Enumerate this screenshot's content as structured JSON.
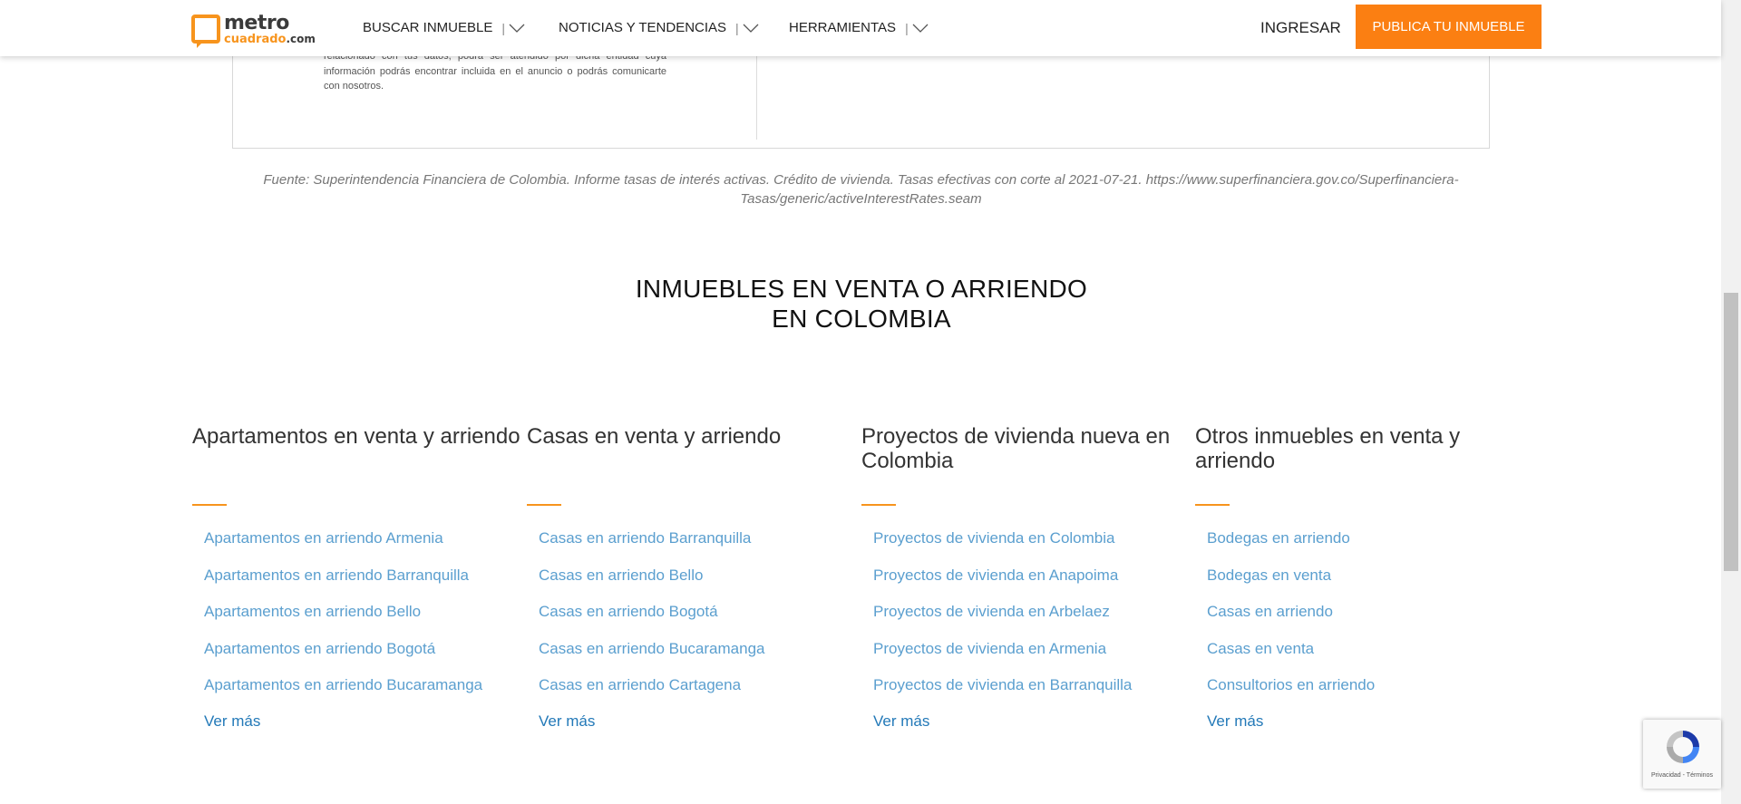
{
  "header": {
    "logo_main": "metro",
    "logo_sub": "cuadrado",
    "logo_tld": ".com",
    "nav": [
      {
        "label": "BUSCAR INMUEBLE"
      },
      {
        "label": "NOTICIAS Y TENDENCIAS"
      },
      {
        "label": "HERRAMIENTAS"
      }
    ],
    "separator": "|",
    "login_label": "INGRESAR",
    "publish_label": "PUBLICA TU INMUEBLE"
  },
  "card": {
    "text_partial": "relacionado con tus datos, podrá ser atendido por dicha entidad cuya información podrás encontrar incluida en el anuncio o podrás comunicarte con nosotros."
  },
  "source_note": "Fuente: Superintendencia Financiera de Colombia. Informe tasas de interés activas. Crédito de vivienda. Tasas efectivas con corte al 2021-07-21. https://www.superfinanciera.gov.co/Superfinanciera-Tasas/generic/activeInterestRates.seam",
  "section": {
    "title_line1": "INMUEBLES EN VENTA O ARRIENDO",
    "title_line2": "EN COLOMBIA",
    "columns": [
      {
        "heading": "Apartamentos en venta y arriendo",
        "links": [
          "Apartamentos en arriendo Armenia",
          "Apartamentos en arriendo Barranquilla",
          "Apartamentos en arriendo Bello",
          "Apartamentos en arriendo Bogotá",
          "Apartamentos en arriendo Bucaramanga"
        ],
        "more": "Ver más"
      },
      {
        "heading": "Casas en venta y arriendo",
        "links": [
          "Casas en arriendo Barranquilla",
          "Casas en arriendo Bello",
          "Casas en arriendo Bogotá",
          "Casas en arriendo Bucaramanga",
          "Casas en arriendo Cartagena"
        ],
        "more": "Ver más"
      },
      {
        "heading": "Proyectos de vivienda nueva en Colombia",
        "links": [
          "Proyectos de vivienda en Colombia",
          "Proyectos de vivienda en Anapoima",
          "Proyectos de vivienda en Arbelaez",
          "Proyectos de vivienda en Armenia",
          "Proyectos de vivienda en Barranquilla"
        ],
        "more": "Ver más"
      },
      {
        "heading": "Otros inmuebles en venta y arriendo",
        "links": [
          "Bodegas en arriendo",
          "Bodegas en venta",
          "Casas en arriendo",
          "Casas en venta",
          "Consultorios en arriendo"
        ],
        "more": "Ver más"
      }
    ]
  },
  "recaptcha": {
    "terms": "Privacidad - Términos"
  },
  "colors": {
    "accent": "#fb7f12",
    "link": "#5b9fcf",
    "link_strong": "#2379b8"
  },
  "icons": [
    "chevron-down-icon",
    "recaptcha-icon"
  ]
}
